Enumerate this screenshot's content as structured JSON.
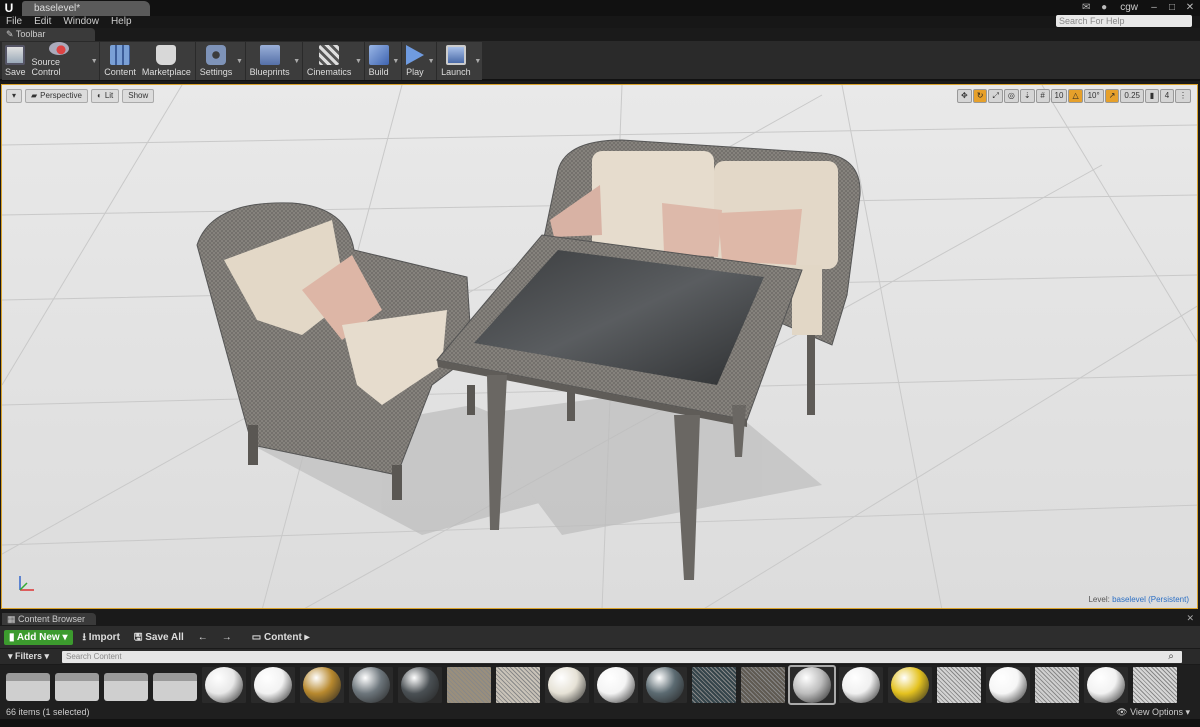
{
  "titlebar": {
    "doc_tab": "baselevel*",
    "user": "cgw",
    "minimize": "–",
    "maximize": "□",
    "close": "✕"
  },
  "menu": [
    "File",
    "Edit",
    "Window",
    "Help"
  ],
  "help_search": {
    "placeholder": "Search For Help"
  },
  "toolbar_tab": "Toolbar",
  "toolbar": {
    "save": "Save",
    "source_control": "Source Control",
    "content": "Content",
    "marketplace": "Marketplace",
    "settings": "Settings",
    "blueprints": "Blueprints",
    "cinematics": "Cinematics",
    "build": "Build",
    "play": "Play",
    "launch": "Launch"
  },
  "viewport": {
    "perspective": "Perspective",
    "lit": "Lit",
    "show": "Show",
    "grid_snap": "10",
    "rot_snap": "10°",
    "scale_snap": "0.25",
    "cam_speed": "4",
    "level_prefix": "Level:",
    "level_name": "baselevel (Persistent)"
  },
  "content_browser": {
    "tab": "Content Browser",
    "add_new": "Add New",
    "import": "Import",
    "save_all": "Save All",
    "path": "Content",
    "filters": "Filters",
    "search_placeholder": "Search Content",
    "status": "66 items (1 selected)",
    "view_options": "View Options"
  },
  "colors": {
    "accent": "#d9a22b",
    "add_new_green": "#3c9b2e",
    "panel_bg": "#2d2d2d"
  },
  "assets": [
    {
      "kind": "folder",
      "color": "#cfcfcf"
    },
    {
      "kind": "folder",
      "color": "#cfcfcf"
    },
    {
      "kind": "folder",
      "color": "#cfcfcf"
    },
    {
      "kind": "folder",
      "color": "#cfcfcf"
    },
    {
      "kind": "sphere",
      "color": "#e8e8e8"
    },
    {
      "kind": "sphere",
      "color": "#f2f2f2"
    },
    {
      "kind": "sphere",
      "color": "#b8892e"
    },
    {
      "kind": "sphere",
      "color": "#6d767c"
    },
    {
      "kind": "sphere",
      "color": "#4a5054"
    },
    {
      "kind": "texture",
      "color": "#9a8f7c"
    },
    {
      "kind": "texture",
      "color": "#c9c3b8"
    },
    {
      "kind": "sphere",
      "color": "#e6e2d6"
    },
    {
      "kind": "sphere",
      "color": "#f4f4f4"
    },
    {
      "kind": "sphere",
      "color": "#5c6b72"
    },
    {
      "kind": "texture",
      "color": "#34444a"
    },
    {
      "kind": "texture",
      "color": "#5f5a52"
    },
    {
      "kind": "sphere",
      "color": "#bdbdbd"
    },
    {
      "kind": "sphere",
      "color": "#f0f0f0"
    },
    {
      "kind": "sphere",
      "color": "#e4c21f"
    },
    {
      "kind": "texture",
      "color": "#d3d3d3"
    },
    {
      "kind": "sphere",
      "color": "#f6f6f6"
    },
    {
      "kind": "texture",
      "color": "#cfcfcf"
    },
    {
      "kind": "sphere",
      "color": "#f2f2f2"
    },
    {
      "kind": "texture",
      "color": "#d6d6d6"
    }
  ]
}
